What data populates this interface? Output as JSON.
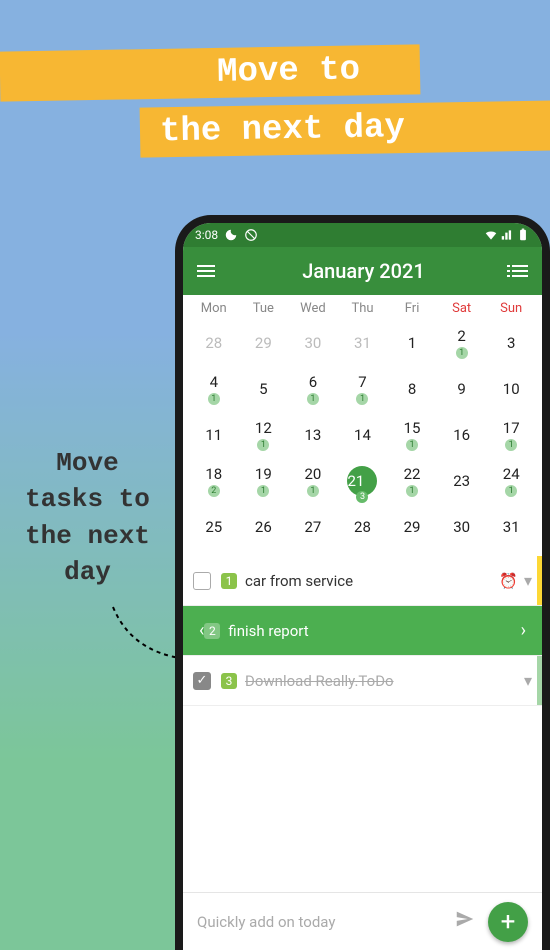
{
  "promo": {
    "line1": "Move to",
    "line2": "the next day",
    "side": "Move tasks to the next day"
  },
  "statusbar": {
    "time": "3:08"
  },
  "appbar": {
    "title": "January 2021"
  },
  "dow": [
    "Mon",
    "Tue",
    "Wed",
    "Thu",
    "Fri",
    "Sat",
    "Sun"
  ],
  "weeks": [
    [
      {
        "n": 28,
        "dim": true
      },
      {
        "n": 29,
        "dim": true
      },
      {
        "n": 30,
        "dim": true
      },
      {
        "n": 31,
        "dim": true
      },
      {
        "n": 1
      },
      {
        "n": 2,
        "c": 1
      },
      {
        "n": 3
      }
    ],
    [
      {
        "n": 4,
        "c": 1
      },
      {
        "n": 5
      },
      {
        "n": 6,
        "c": 1
      },
      {
        "n": 7,
        "c": 1
      },
      {
        "n": 8
      },
      {
        "n": 9
      },
      {
        "n": 10
      }
    ],
    [
      {
        "n": 11
      },
      {
        "n": 12,
        "c": 1
      },
      {
        "n": 13
      },
      {
        "n": 14
      },
      {
        "n": 15,
        "c": 1
      },
      {
        "n": 16
      },
      {
        "n": 17,
        "c": 1
      }
    ],
    [
      {
        "n": 18,
        "c": 2
      },
      {
        "n": 19,
        "c": 1
      },
      {
        "n": 20,
        "c": 1
      },
      {
        "n": 21,
        "c": 3,
        "sel": true
      },
      {
        "n": 22,
        "c": 1
      },
      {
        "n": 23
      },
      {
        "n": 24,
        "c": 1
      }
    ],
    [
      {
        "n": 25
      },
      {
        "n": 26
      },
      {
        "n": 27
      },
      {
        "n": 28
      },
      {
        "n": 29
      },
      {
        "n": 30
      },
      {
        "n": 31
      }
    ]
  ],
  "tasks": [
    {
      "idx": "1",
      "text": "car from service",
      "done": false,
      "alarm": true
    },
    {
      "idx": "2",
      "text": "finish report",
      "swipe": true
    },
    {
      "idx": "3",
      "text": "Download Really.ToDo",
      "done": true
    }
  ],
  "bottombar": {
    "placeholder": "Quickly add on  today"
  }
}
